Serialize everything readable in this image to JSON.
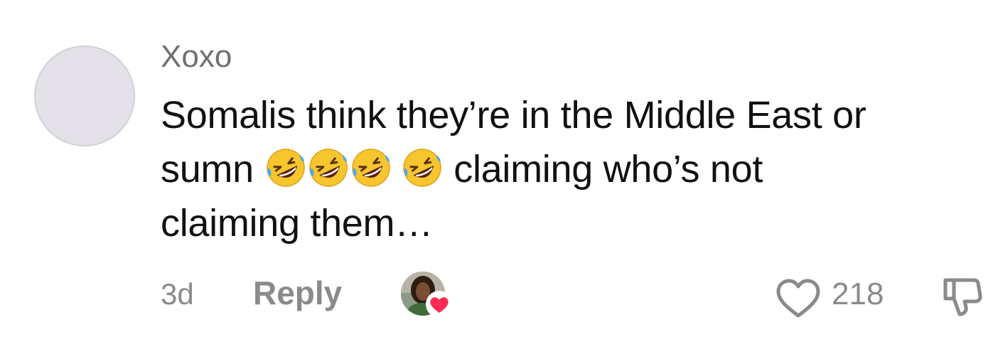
{
  "comment": {
    "username": "Xoxo",
    "text_line1": "Somalis think they’re in the Middle East or",
    "text_line2_start": "sumn",
    "text_line2_end": "claiming who’s not",
    "text_line3": "claiming them…",
    "emojis": [
      "rolling-on-floor-laughing",
      "rolling-on-floor-laughing",
      "rolling-on-floor-laughing",
      "rolling-on-floor-laughing"
    ],
    "timestamp": "3d",
    "reply_label": "Reply",
    "like_count": "218"
  },
  "colors": {
    "avatar_bg": "#e4e1e9",
    "muted_text": "#8a8a8a",
    "body_text": "#111111",
    "liked_heart": "#fe2c55"
  },
  "icons": {
    "like": "heart-outline-icon",
    "dislike": "thumbs-down-icon",
    "creator_liked": "heart-filled-icon"
  }
}
